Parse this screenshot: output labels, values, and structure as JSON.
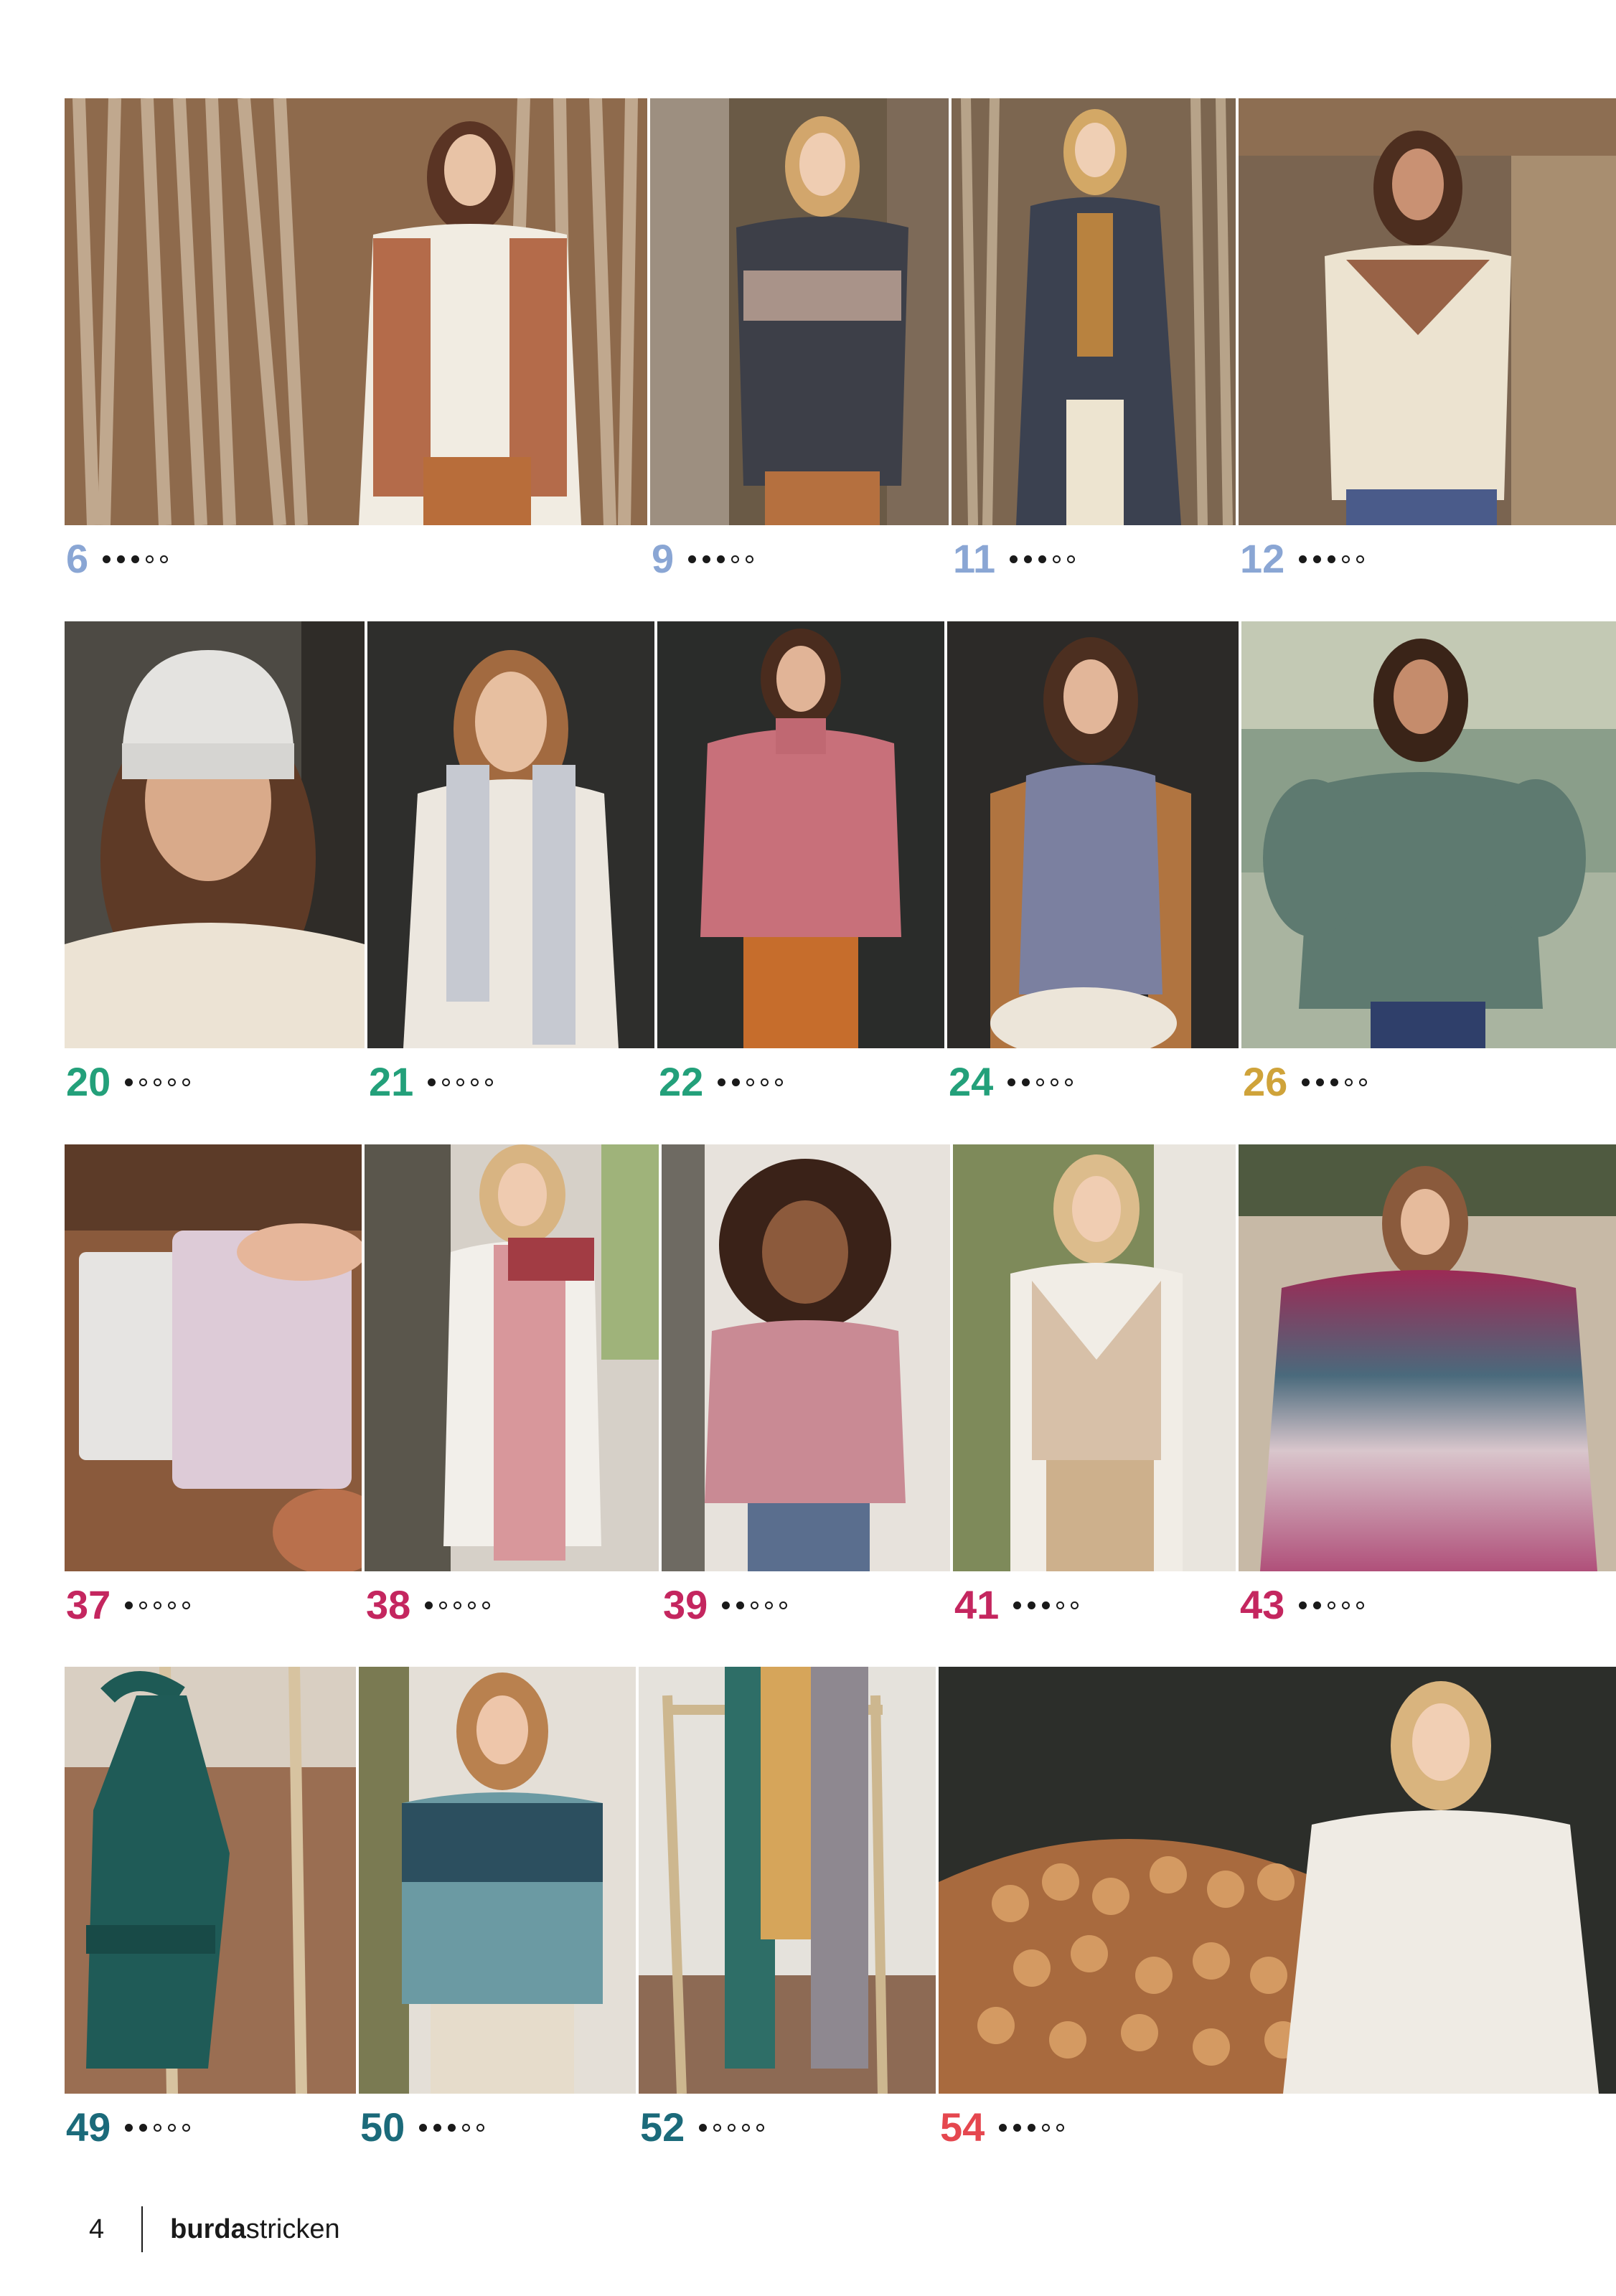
{
  "colors": {
    "blue": "#8aa6d4",
    "green": "#23a07a",
    "gold": "#cfa33a",
    "magenta": "#c4265f",
    "teal": "#1b6a7a",
    "coral": "#e5474f"
  },
  "rows": [
    [
      {
        "number": "6",
        "level": 3,
        "color": "blue",
        "image": "Woman in cream sweater with granny-square sleeves, in front of wooden sticks"
      },
      {
        "number": "9",
        "level": 3,
        "color": "blue",
        "image": "Woman in dark grey fair-isle patterned sweater in forest"
      },
      {
        "number": "11",
        "level": 3,
        "color": "blue",
        "image": "Woman in long dark striped knitted coat in forest"
      },
      {
        "number": "12",
        "level": 3,
        "color": "blue",
        "image": "Woman in cream sweater with fair-isle yoke, leaning on wooden hut"
      }
    ],
    [
      {
        "number": "20",
        "level": 1,
        "color": "green",
        "image": "Woman wearing light grey knitted beanie"
      },
      {
        "number": "21",
        "level": 1,
        "color": "green",
        "image": "Woman with light grey knitted scarf with fringes"
      },
      {
        "number": "22",
        "level": 2,
        "color": "green",
        "image": "Woman in pink turtleneck sweater by dark wooden wall"
      },
      {
        "number": "24",
        "level": 2,
        "color": "green",
        "image": "Woman in grey knitted vest with mock neck"
      },
      {
        "number": "26",
        "level": 3,
        "color": "gold",
        "image": "Woman in green sweater with balloon sleeves by a lake"
      }
    ],
    [
      {
        "number": "37",
        "level": 1,
        "color": "magenta",
        "image": "Pastel speckled knitted laptop sleeve on wooden table"
      },
      {
        "number": "38",
        "level": 1,
        "color": "magenta",
        "image": "Woman with pink and red gradient knitted scarf"
      },
      {
        "number": "39",
        "level": 2,
        "color": "magenta",
        "image": "Child in pink ribbed sweater with pocket"
      },
      {
        "number": "41",
        "level": 3,
        "color": "magenta",
        "image": "Woman in beige short-sleeve wrap cardigan"
      },
      {
        "number": "43",
        "level": 2,
        "color": "magenta",
        "image": "Woman in magenta to pink gradient textured poncho"
      }
    ],
    [
      {
        "number": "49",
        "level": 2,
        "color": "teal",
        "image": "Dark green knitted shoulder bag hanging on a chair"
      },
      {
        "number": "50",
        "level": 3,
        "color": "teal",
        "image": "Woman in teal sweater with fair-isle yoke"
      },
      {
        "number": "52",
        "level": 1,
        "color": "teal",
        "image": "Mustard and grey scarves draped over a bamboo chair"
      },
      {
        "number": "54",
        "level": 3,
        "color": "coral",
        "image": "Woman in white cable knit poncho in front of stacked firewood"
      }
    ]
  ],
  "footer": {
    "page": "4",
    "brand_bold": "burda",
    "brand_rest": "stricken"
  }
}
